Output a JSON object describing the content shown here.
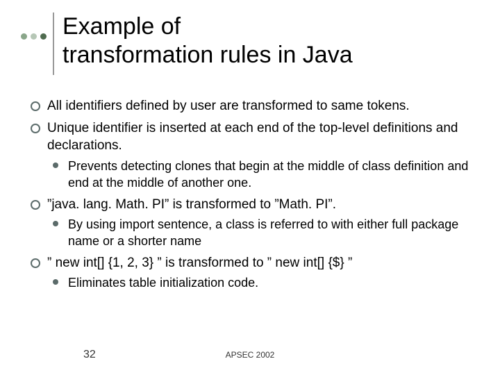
{
  "title": "Example of\n  transformation rules in Java",
  "bullets": [
    {
      "text": "All identifiers defined by user are transformed to same tokens.",
      "sub": []
    },
    {
      "text": "Unique identifier is inserted at each end of the top-level definitions and declarations.",
      "sub": [
        "Prevents detecting clones that begin at the middle of class definition and end at the middle of another one."
      ]
    },
    {
      "text": "”java. lang. Math. PI” is transformed to ”Math. PI”.",
      "sub": [
        "By using import sentence, a class is referred to with either full package name or a shorter name"
      ]
    },
    {
      "text": "” new int[] {1, 2, 3} ”  is transformed to ” new int[] {$} ”",
      "sub": [
        "Eliminates table initialization code."
      ]
    }
  ],
  "footer": {
    "page": "32",
    "conference": "APSEC 2002"
  }
}
